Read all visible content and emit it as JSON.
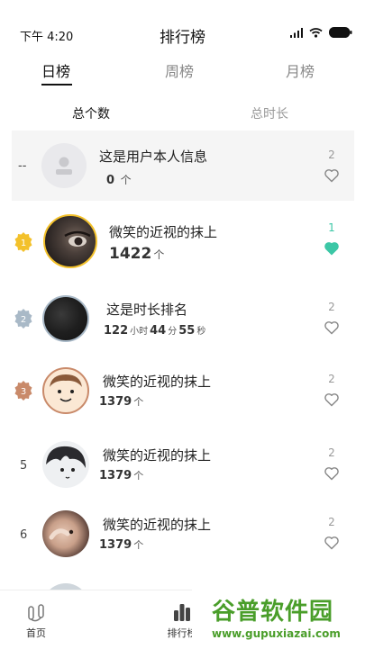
{
  "status": {
    "time": "下午 4:20"
  },
  "nav": {
    "title": "排行榜"
  },
  "tabs": [
    {
      "label": "日榜"
    },
    {
      "label": "周榜"
    },
    {
      "label": "月榜"
    }
  ],
  "subtabs": [
    {
      "label": "总个数"
    },
    {
      "label": "总时长"
    }
  ],
  "self": {
    "rank": "--",
    "name": "这是用户本人信息",
    "value": "0",
    "unit": "个",
    "likes": "2"
  },
  "rows": [
    {
      "rank": "1",
      "name": "微笑的近视的抹上",
      "value": "1422",
      "unit": "个",
      "likes": "1",
      "liked": true
    },
    {
      "rank": "2",
      "name": "这是时长排名",
      "hours": "122",
      "hours_unit": "小时",
      "minutes": "44",
      "minutes_unit": "分",
      "seconds": "55",
      "seconds_unit": "秒",
      "likes": "2"
    },
    {
      "rank": "3",
      "name": "微笑的近视的抹上",
      "value": "1379",
      "unit": "个",
      "likes": "2"
    },
    {
      "rank": "5",
      "name": "微笑的近视的抹上",
      "value": "1379",
      "unit": "个",
      "likes": "2"
    },
    {
      "rank": "6",
      "name": "微笑的近视的抹上",
      "value": "1379",
      "unit": "个",
      "likes": "2"
    }
  ],
  "bottom_nav": [
    {
      "label": "首页"
    },
    {
      "label": "排行榜"
    }
  ],
  "watermark": {
    "title": "谷普软件园",
    "url": "www.gupuxiazai.com"
  },
  "colors": {
    "accent": "#3cc7a6",
    "gold": "#f3c12b",
    "silver": "#a9b9c7",
    "bronze": "#c98a6a"
  }
}
